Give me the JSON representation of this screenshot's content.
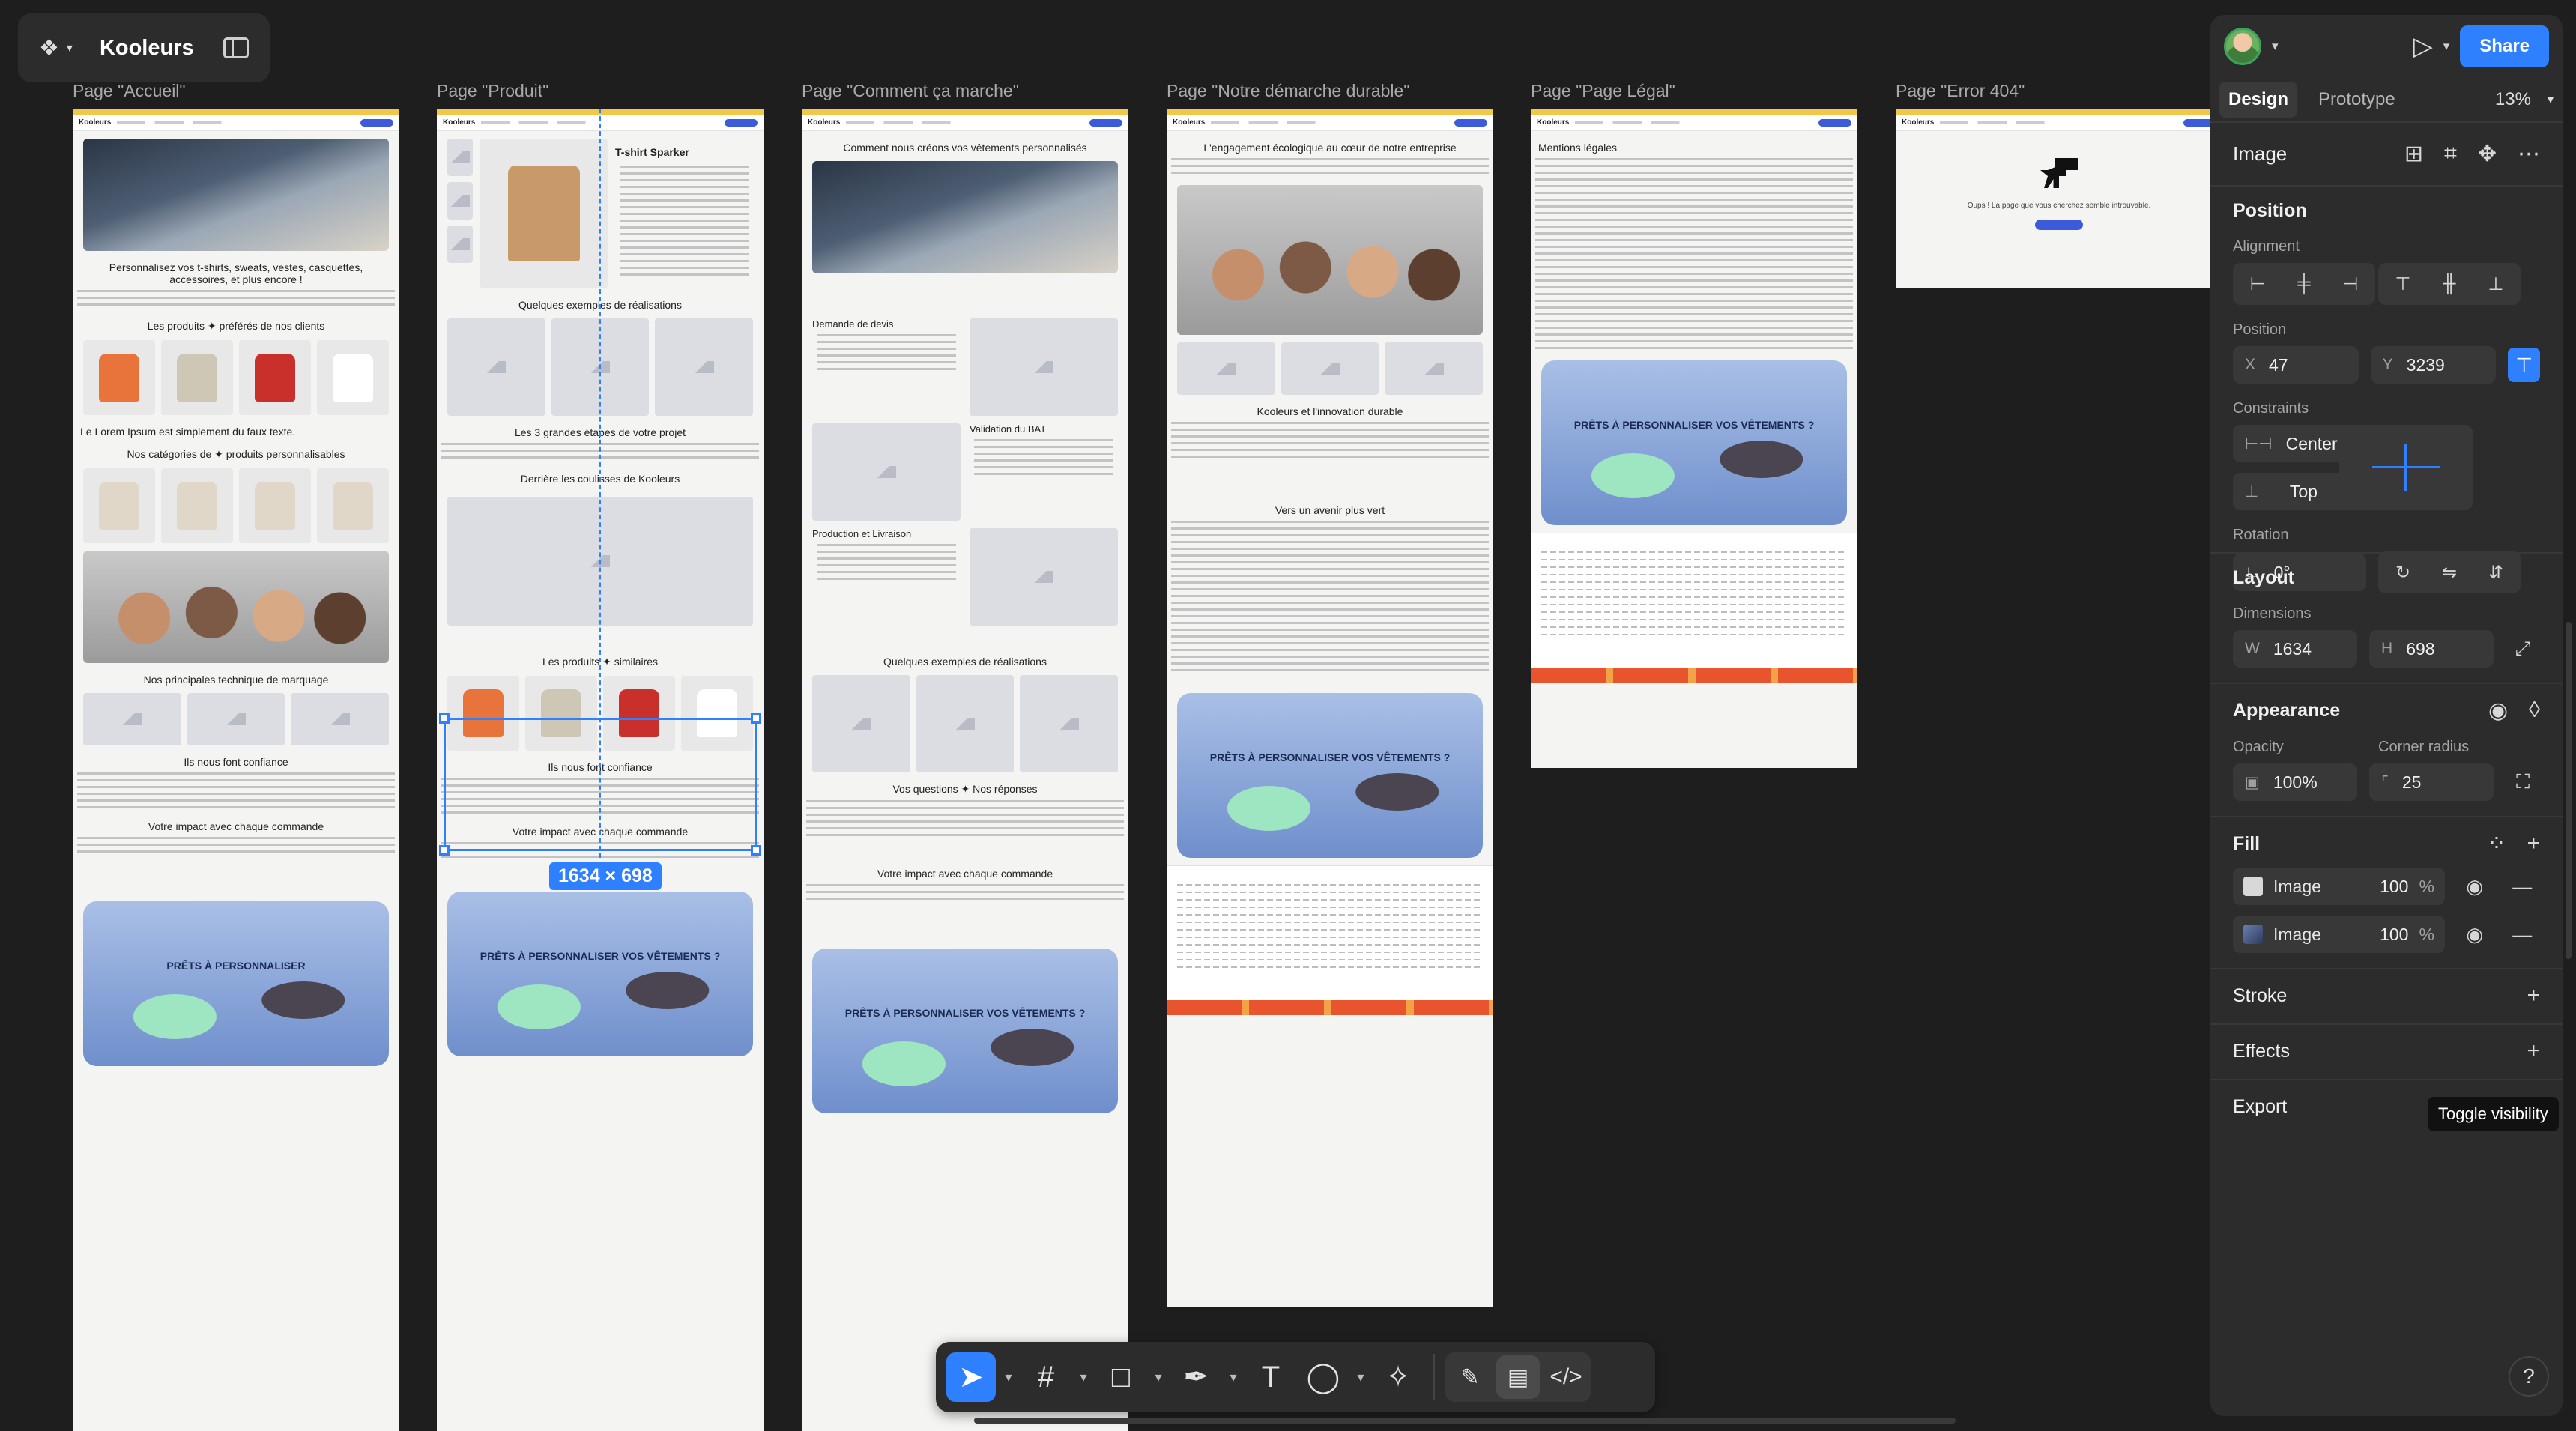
{
  "project": {
    "title": "Kooleurs"
  },
  "frames": [
    {
      "label": "Page \"Accueil\""
    },
    {
      "label": "Page \"Produit\""
    },
    {
      "label": "Page \"Comment ça marche\""
    },
    {
      "label": "Page \"Notre démarche durable\""
    },
    {
      "label": "Page \"Page Légal\""
    },
    {
      "label": "Page \"Error 404\""
    }
  ],
  "canvas": {
    "accueil": {
      "heading1": "Personnalisez vos t-shirts, sweats, vestes, casquettes, accessoires, et plus encore !",
      "heading2": "Les produits ✦ préférés de nos clients",
      "heading3": "Le Lorem Ipsum est simplement du faux texte.",
      "heading4": "Nos catégories de ✦ produits personnalisables",
      "heading5": "Nos principales technique de marquage",
      "heading6": "Ils nous font confiance",
      "heading7": "Votre impact avec chaque commande",
      "cta_text": "PRÊTS À PERSONNALISER"
    },
    "produit": {
      "product_title": "T-shirt Sparker",
      "heading1": "Quelques exemples de réalisations",
      "heading2": "Les 3 grandes étapes de votre projet",
      "heading3": "Derrière les coulisses de Kooleurs",
      "heading4": "Les produits ✦ similaires",
      "heading5": "Ils nous font confiance",
      "heading6": "Votre impact avec chaque commande",
      "cta_text": "PRÊTS À PERSONNALISER VOS VÊTEMENTS ?"
    },
    "comment": {
      "heading1": "Comment nous créons vos vêtements personnalisés",
      "step1": "Demande de devis",
      "step2": "Validation du BAT",
      "step3": "Production et Livraison",
      "heading2": "Quelques exemples de réalisations",
      "heading3": "Vos questions ✦ Nos réponses",
      "heading4": "Votre impact avec chaque commande",
      "cta_text": "PRÊTS À PERSONNALISER VOS VÊTEMENTS ?"
    },
    "durable": {
      "heading1": "L'engagement écologique au cœur de notre entreprise",
      "heading2": "Kooleurs et l'innovation durable",
      "heading3": "Vers un avenir plus vert",
      "cta_text": "PRÊTS À PERSONNALISER VOS VÊTEMENTS ?"
    },
    "legal": {
      "heading1": "Mentions légales",
      "cta_text": "PRÊTS À PERSONNALISER VOS VÊTEMENTS ?"
    },
    "error": {
      "message": "Oups ! La page que vous cherchez semble introuvable."
    },
    "selection_size": "1634 × 698"
  },
  "toolbar": {
    "tools": [
      "move-tool",
      "frame-tool",
      "shape-tool",
      "pen-tool",
      "text-tool",
      "comment-tool",
      "actions-tool"
    ],
    "modes": [
      "draw-mode",
      "design-mode",
      "dev-mode"
    ]
  },
  "panel": {
    "share_label": "Share",
    "tabs": {
      "design": "Design",
      "prototype": "Prototype"
    },
    "zoom": "13%",
    "layer_type": "Image",
    "position": {
      "title": "Position",
      "alignment_label": "Alignment",
      "position_label": "Position",
      "x_label": "X",
      "x": "47",
      "y_label": "Y",
      "y": "3239",
      "constraints_label": "Constraints",
      "constraint_h": "Center",
      "constraint_v": "Top",
      "rotation_label": "Rotation",
      "rotation": "0°"
    },
    "layout": {
      "title": "Layout",
      "dimensions_label": "Dimensions",
      "w_label": "W",
      "w": "1634",
      "h_label": "H",
      "h": "698"
    },
    "appearance": {
      "title": "Appearance",
      "opacity_label": "Opacity",
      "opacity": "100%",
      "radius_label": "Corner radius",
      "radius": "25"
    },
    "fill": {
      "title": "Fill",
      "items": [
        {
          "name": "Image",
          "opacity": "100",
          "unit": "%"
        },
        {
          "name": "Image",
          "opacity": "100",
          "unit": "%"
        }
      ]
    },
    "tooltip": "Toggle visibility",
    "stroke": "Stroke",
    "effects": "Effects",
    "export": "Export"
  },
  "colors": {
    "accent": "#2f80ff",
    "panel": "#2c2c2c",
    "canvas": "#1e1e1e"
  }
}
